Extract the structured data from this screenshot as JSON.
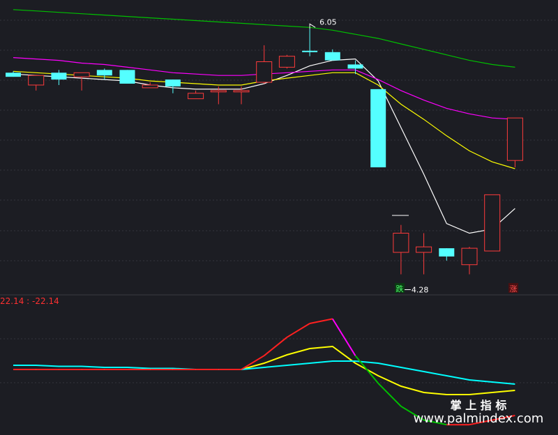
{
  "chart_data": [
    {
      "type": "candlestick",
      "panel": "price",
      "annotations": {
        "high_label": "6.05",
        "low_label": "4.28",
        "down_marker": "跌",
        "up_marker": "涨"
      },
      "ylim": [
        4.1,
        6.25
      ],
      "candles": [
        {
          "o": 5.72,
          "h": 5.73,
          "l": 5.69,
          "c": 5.69
        },
        {
          "o": 5.63,
          "h": 5.7,
          "l": 5.59,
          "c": 5.7
        },
        {
          "o": 5.72,
          "h": 5.74,
          "l": 5.63,
          "c": 5.67
        },
        {
          "o": 5.69,
          "h": 5.72,
          "l": 5.59,
          "c": 5.72
        },
        {
          "o": 5.74,
          "h": 5.75,
          "l": 5.67,
          "c": 5.7
        },
        {
          "o": 5.74,
          "h": 5.74,
          "l": 5.64,
          "c": 5.64
        },
        {
          "o": 5.61,
          "h": 5.65,
          "l": 5.61,
          "c": 5.63
        },
        {
          "o": 5.67,
          "h": 5.67,
          "l": 5.57,
          "c": 5.62
        },
        {
          "o": 5.53,
          "h": 5.59,
          "l": 5.53,
          "c": 5.57
        },
        {
          "o": 5.59,
          "h": 5.62,
          "l": 5.49,
          "c": 5.59
        },
        {
          "o": 5.59,
          "h": 5.62,
          "l": 5.49,
          "c": 5.59
        },
        {
          "o": 5.65,
          "h": 5.92,
          "l": 5.64,
          "c": 5.8
        },
        {
          "o": 5.76,
          "h": 5.85,
          "l": 5.75,
          "c": 5.84
        },
        {
          "o": 5.88,
          "h": 6.04,
          "l": 5.84,
          "c": 5.87
        },
        {
          "o": 5.87,
          "h": 5.89,
          "l": 5.81,
          "c": 5.81
        },
        {
          "o": 5.78,
          "h": 5.81,
          "l": 5.71,
          "c": 5.75
        },
        {
          "o": 5.6,
          "h": 5.6,
          "l": 5.17,
          "c": 5.03
        },
        {
          "o": 4.41,
          "h": 4.61,
          "l": 4.25,
          "c": 4.55
        },
        {
          "o": 4.41,
          "h": 4.55,
          "l": 4.25,
          "c": 4.45
        },
        {
          "o": 4.44,
          "h": 4.44,
          "l": 4.35,
          "c": 4.38
        },
        {
          "o": 4.32,
          "h": 4.45,
          "l": 4.25,
          "c": 4.44
        },
        {
          "o": 4.42,
          "h": 4.83,
          "l": 4.42,
          "c": 4.83
        },
        {
          "o": 5.08,
          "h": 5.39,
          "l": 5.03,
          "c": 5.39
        }
      ],
      "series": [
        {
          "color": "#ffffff",
          "values": [
            5.71,
            5.7,
            5.69,
            5.68,
            5.67,
            5.66,
            5.63,
            5.61,
            5.6,
            5.6,
            5.6,
            5.64,
            5.7,
            5.77,
            5.81,
            5.82,
            5.66,
            5.32,
            4.98,
            4.62,
            4.55,
            4.58,
            4.73
          ]
        },
        {
          "color": "#ffff00",
          "values": [
            5.73,
            5.72,
            5.71,
            5.7,
            5.69,
            5.68,
            5.66,
            5.65,
            5.64,
            5.63,
            5.63,
            5.66,
            5.68,
            5.7,
            5.72,
            5.72,
            5.63,
            5.49,
            5.38,
            5.26,
            5.15,
            5.07,
            5.02
          ]
        },
        {
          "color": "#ff00ff",
          "values": [
            5.83,
            5.82,
            5.81,
            5.79,
            5.78,
            5.76,
            5.74,
            5.72,
            5.71,
            5.7,
            5.7,
            5.71,
            5.72,
            5.73,
            5.74,
            5.74,
            5.67,
            5.59,
            5.52,
            5.46,
            5.42,
            5.39,
            5.38
          ]
        },
        {
          "color": "#00c000",
          "values": [
            6.18,
            6.17,
            6.16,
            6.15,
            6.14,
            6.13,
            6.12,
            6.11,
            6.1,
            6.09,
            6.08,
            6.07,
            6.06,
            6.05,
            6.03,
            6.0,
            5.97,
            5.93,
            5.89,
            5.85,
            5.81,
            5.78,
            5.76
          ]
        }
      ]
    },
    {
      "type": "line",
      "panel": "indicator",
      "title": "22.14 : -22.14",
      "ylim": [
        -30,
        30
      ],
      "series": [
        {
          "color": "#ffff00",
          "values": [
            0,
            0,
            0,
            0,
            0,
            0,
            0,
            0,
            0,
            0,
            0,
            3,
            7,
            10,
            11,
            3,
            -3,
            -8,
            -11,
            -12,
            -12,
            -11,
            -10
          ]
        },
        {
          "color": "#00ffff",
          "values": [
            2,
            2,
            1.5,
            1.5,
            1,
            1,
            0.5,
            0.5,
            0,
            0,
            0,
            1,
            2,
            3,
            4,
            4,
            3,
            1,
            -1,
            -3,
            -5,
            -6,
            -7
          ]
        }
      ]
    }
  ],
  "watermark": {
    "line1": "掌 上 指 标",
    "line2": "www.palmindex.com"
  }
}
